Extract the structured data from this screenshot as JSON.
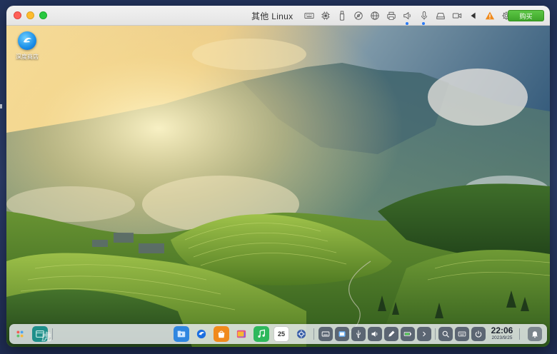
{
  "window": {
    "title": "其他 Linux",
    "buy_label": "购买"
  },
  "titlebar_icons": [
    {
      "name": "keyboard-icon"
    },
    {
      "name": "cpu-icon"
    },
    {
      "name": "usb-drive-icon"
    },
    {
      "name": "disc-icon"
    },
    {
      "name": "network-globe-icon"
    },
    {
      "name": "printer-icon"
    },
    {
      "name": "speaker-icon"
    },
    {
      "name": "microphone-icon"
    },
    {
      "name": "hard-drive-icon"
    },
    {
      "name": "camera-icon"
    },
    {
      "name": "arrow-left-icon"
    },
    {
      "name": "warning-icon"
    },
    {
      "name": "gear-icon"
    }
  ],
  "desktop": {
    "icon_label": "深度商店"
  },
  "host": {
    "watermark": "虎"
  },
  "dock": {
    "apps": [
      {
        "name": "launcher-icon"
      },
      {
        "name": "multitask-view-icon"
      },
      {
        "name": "file-manager-icon"
      },
      {
        "name": "browser-icon"
      },
      {
        "name": "app-store-icon"
      },
      {
        "name": "image-viewer-icon"
      },
      {
        "name": "music-icon"
      },
      {
        "name": "calendar-icon",
        "label": "25"
      },
      {
        "name": "control-center-icon"
      }
    ],
    "tray": [
      {
        "name": "onscreen-keyboard-icon"
      },
      {
        "name": "screenshot-icon"
      },
      {
        "name": "usb-icon"
      },
      {
        "name": "volume-icon"
      },
      {
        "name": "pen-icon"
      },
      {
        "name": "battery-icon"
      },
      {
        "name": "tray-expand-icon"
      },
      {
        "name": "search-icon"
      },
      {
        "name": "keyboard-layout-icon"
      },
      {
        "name": "power-icon"
      }
    ],
    "clock": {
      "time": "22:06",
      "date": "2023/9/25"
    }
  },
  "colors": {
    "buy_button": "#3ea52a",
    "warning": "#f08a1c"
  }
}
